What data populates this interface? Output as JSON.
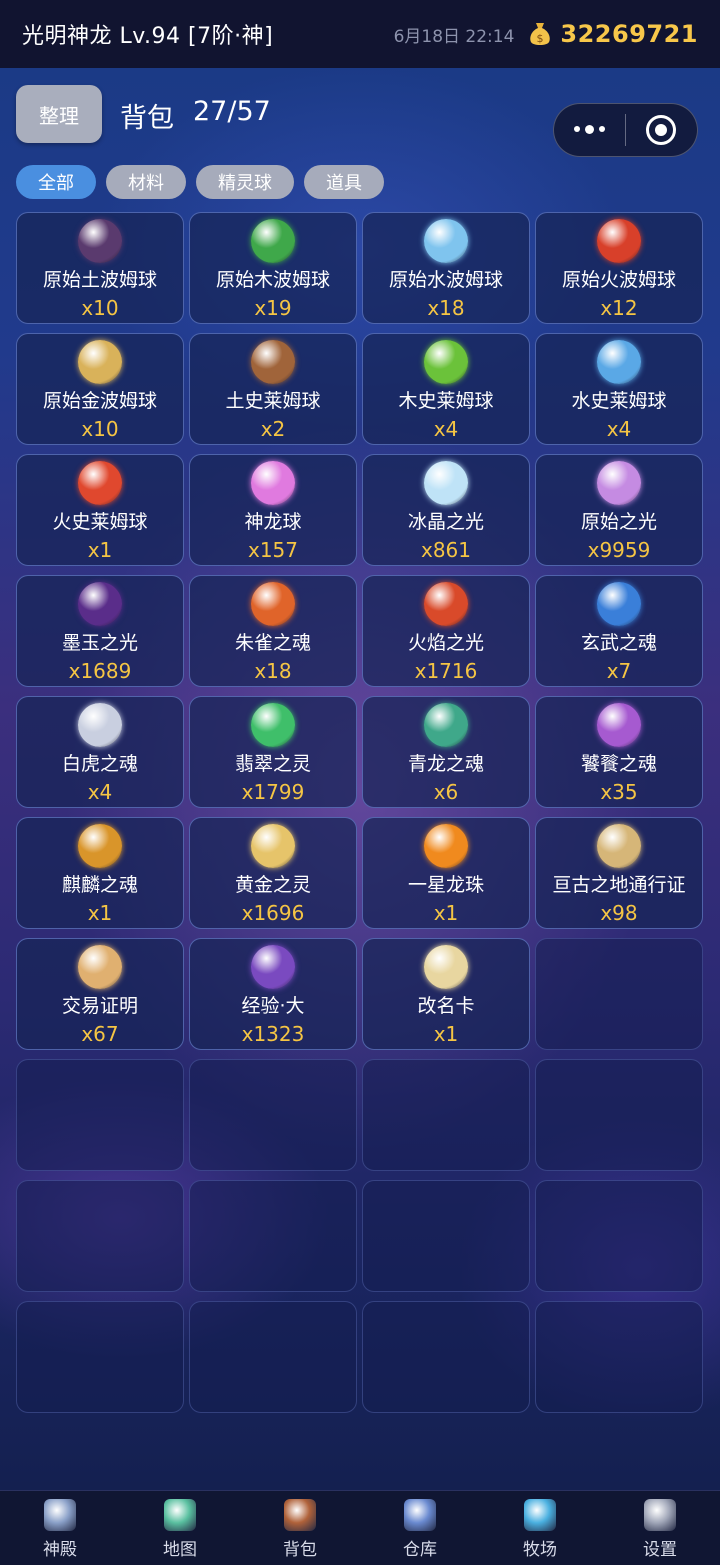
{
  "status": {
    "player": "光明神龙 Lv.94 [7阶·神]",
    "datetime": "6月18日 22:14",
    "gold": "32269721"
  },
  "header": {
    "sort_label": "整理",
    "bag_title": "背包",
    "bag_count": "27/57"
  },
  "tabs": [
    {
      "label": "全部",
      "active": true
    },
    {
      "label": "材料",
      "active": false
    },
    {
      "label": "精灵球",
      "active": false
    },
    {
      "label": "道具",
      "active": false
    }
  ],
  "items": [
    {
      "name": "原始土波姆球",
      "qty": "x10",
      "icon": "earth-ball-icon",
      "color": "#5a3a6e"
    },
    {
      "name": "原始木波姆球",
      "qty": "x19",
      "icon": "wood-ball-icon",
      "color": "#3fa84a"
    },
    {
      "name": "原始水波姆球",
      "qty": "x18",
      "icon": "water-ball-icon",
      "color": "#7fc4ee"
    },
    {
      "name": "原始火波姆球",
      "qty": "x12",
      "icon": "fire-ball-icon",
      "color": "#d8402a"
    },
    {
      "name": "原始金波姆球",
      "qty": "x10",
      "icon": "gold-ball-icon",
      "color": "#d9b25a"
    },
    {
      "name": "土史莱姆球",
      "qty": "x2",
      "icon": "earth-slime-ball-icon",
      "color": "#a0643a"
    },
    {
      "name": "木史莱姆球",
      "qty": "x4",
      "icon": "wood-slime-ball-icon",
      "color": "#6bc23a"
    },
    {
      "name": "水史莱姆球",
      "qty": "x4",
      "icon": "water-slime-ball-icon",
      "color": "#5aa8e6"
    },
    {
      "name": "火史莱姆球",
      "qty": "x1",
      "icon": "fire-slime-ball-icon",
      "color": "#e0482e"
    },
    {
      "name": "神龙球",
      "qty": "x157",
      "icon": "dragon-ball-icon",
      "color": "#e07adf"
    },
    {
      "name": "冰晶之光",
      "qty": "x861",
      "icon": "ice-crystal-icon",
      "color": "#bfe3f7"
    },
    {
      "name": "原始之光",
      "qty": "x9959",
      "icon": "primal-light-icon",
      "color": "#c58be2"
    },
    {
      "name": "墨玉之光",
      "qty": "x1689",
      "icon": "black-jade-icon",
      "color": "#5a2d8a"
    },
    {
      "name": "朱雀之魂",
      "qty": "x18",
      "icon": "vermilion-bird-icon",
      "color": "#e0642a"
    },
    {
      "name": "火焰之光",
      "qty": "x1716",
      "icon": "flame-light-icon",
      "color": "#d94a2a"
    },
    {
      "name": "玄武之魂",
      "qty": "x7",
      "icon": "black-tortoise-icon",
      "color": "#3a7fd9"
    },
    {
      "name": "白虎之魂",
      "qty": "x4",
      "icon": "white-tiger-icon",
      "color": "#c9cfe0"
    },
    {
      "name": "翡翠之灵",
      "qty": "x1799",
      "icon": "jade-spirit-icon",
      "color": "#3fbf6a"
    },
    {
      "name": "青龙之魂",
      "qty": "x6",
      "icon": "azure-dragon-icon",
      "color": "#3fa88a"
    },
    {
      "name": "饕餮之魂",
      "qty": "x35",
      "icon": "taotie-icon",
      "color": "#a65ad0"
    },
    {
      "name": "麒麟之魂",
      "qty": "x1",
      "icon": "qilin-icon",
      "color": "#d9952a"
    },
    {
      "name": "黄金之灵",
      "qty": "x1696",
      "icon": "golden-spirit-icon",
      "color": "#e6c46a"
    },
    {
      "name": "一星龙珠",
      "qty": "x1",
      "icon": "one-star-orb-icon",
      "color": "#f08a1e"
    },
    {
      "name": "亘古之地通行证",
      "qty": "x98",
      "icon": "pass-scroll-icon",
      "color": "#d6b678"
    },
    {
      "name": "交易证明",
      "qty": "x67",
      "icon": "trade-scroll-icon",
      "color": "#e0b070"
    },
    {
      "name": "经验·大",
      "qty": "x1323",
      "icon": "exp-book-icon",
      "color": "#7a4ac0"
    },
    {
      "name": "改名卡",
      "qty": "x1",
      "icon": "rename-card-icon",
      "color": "#e8d6a0"
    }
  ],
  "nav": [
    {
      "label": "神殿",
      "icon": "temple-icon",
      "color": "#8aa0c8"
    },
    {
      "label": "地图",
      "icon": "map-icon",
      "color": "#5ac0a0"
    },
    {
      "label": "背包",
      "icon": "backpack-icon",
      "color": "#b0623a"
    },
    {
      "label": "仓库",
      "icon": "warehouse-icon",
      "color": "#6a8ad0"
    },
    {
      "label": "牧场",
      "icon": "ranch-icon",
      "color": "#4ab0e0"
    },
    {
      "label": "设置",
      "icon": "settings-icon",
      "color": "#a0a6b8"
    }
  ]
}
